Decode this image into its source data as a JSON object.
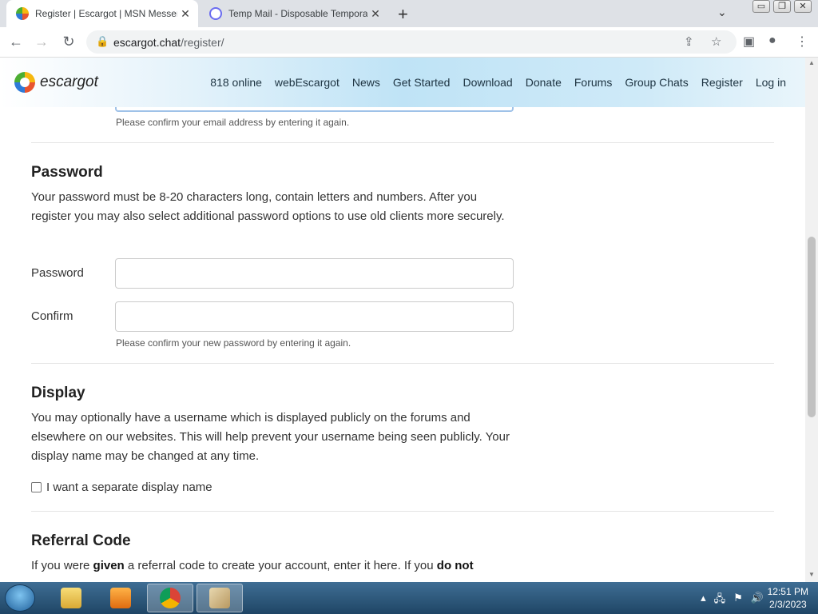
{
  "browser": {
    "tabs": [
      {
        "title": "Register | Escargot | MSN Messenger",
        "active": true
      },
      {
        "title": "Temp Mail - Disposable Temporary Email",
        "active": false
      }
    ],
    "new_tab": "+",
    "tab_close": "✕",
    "tab_dropdown": "⌄",
    "window_controls": {
      "minimize": "▭",
      "restore": "❐",
      "close": "✕"
    },
    "nav": {
      "back": "←",
      "forward": "→",
      "reload": "↻"
    },
    "address": {
      "host": "escargot.chat",
      "path": "/register/",
      "lock": "🔒"
    },
    "icons": {
      "share": "⇪",
      "star": "☆",
      "sidepanel": "▣",
      "profile": "●",
      "menu": "⋮"
    }
  },
  "site": {
    "logo_text": "escargot",
    "nav": [
      "818 online",
      "webEscargot",
      "News",
      "Get Started",
      "Download",
      "Donate",
      "Forums",
      "Group Chats",
      "Register",
      "Log in"
    ]
  },
  "form": {
    "email_confirm_hint": "Please confirm your email address by entering it again.",
    "password": {
      "heading": "Password",
      "description": "Your password must be 8-20 characters long, contain letters and numbers. After you register you may also select additional password options to use old clients more securely.",
      "password_label": "Password",
      "password_value": "",
      "confirm_label": "Confirm",
      "confirm_value": "",
      "confirm_hint": "Please confirm your new password by entering it again."
    },
    "display": {
      "heading": "Display",
      "description": "You may optionally have a username which is displayed publicly on the forums and elsewhere on our websites. This will help prevent your username being seen publicly. Your display name may be changed at any time.",
      "checkbox_label": "I want a separate display name",
      "checked": false
    },
    "referral": {
      "heading": "Referral Code",
      "text_1": "If you were ",
      "text_bold_1": "given",
      "text_2": " a referral code to create your account, enter it here. If you ",
      "text_bold_2": "do not"
    }
  },
  "taskbar": {
    "apps": [
      "windows-explorer",
      "media-player",
      "chrome",
      "paint"
    ],
    "time": "12:51 PM",
    "date": "2/3/2023",
    "tray": {
      "expand": "▴",
      "network": "🖧",
      "flag": "⚑",
      "volume": "🔊"
    }
  },
  "colors": {
    "header_gradient": "#bfe3f6",
    "taskbar": "#2b5577",
    "text": "#333333"
  }
}
